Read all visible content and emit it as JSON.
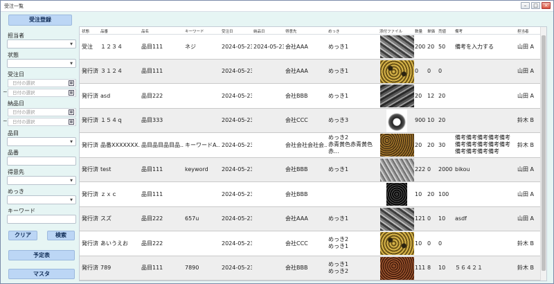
{
  "window": {
    "title": "受注一覧"
  },
  "sidebar": {
    "register_button": "受注登録",
    "tanto_label": "担当者",
    "status_label": "状態",
    "order_date_label": "受注日",
    "delivery_date_label": "納品日",
    "date_placeholder": "日付の選択",
    "tilde": "~",
    "item_label": "品目",
    "part_no_label": "品番",
    "customer_label": "得意先",
    "plating_label": "めっき",
    "keyword_label": "キーワード",
    "clear_button": "クリア",
    "search_button": "検索",
    "schedule_button": "予定表",
    "master_button": "マスタ"
  },
  "grid": {
    "headers": [
      "状態",
      "品番",
      "品名",
      "キーワード",
      "受注日",
      "納品日",
      "得意先",
      "めっき",
      "添付ファイル",
      "数量",
      "単価",
      "売値",
      "備考",
      "担当者"
    ],
    "rows": [
      {
        "status": "受注",
        "part_no": "１２３４",
        "name": "品目111",
        "keyword": "ネジ",
        "order_date": "2024-05-23",
        "delivery_date": "2024-05-23",
        "customer": "会社AAA",
        "plating": "めっき1",
        "thumb": "screws-gray",
        "qty": "200",
        "unit": "20",
        "price": "50",
        "note": "備考を入力する",
        "tanto": "山田 A"
      },
      {
        "status": "発行済",
        "part_no": "３１２４",
        "name": "品目111",
        "keyword": "",
        "order_date": "2024-05-23",
        "delivery_date": "",
        "customer": "会社AAA",
        "plating": "めっき1",
        "thumb": "rings-gold",
        "qty": "0",
        "unit": "0",
        "price": "0",
        "note": "",
        "tanto": "山田 A"
      },
      {
        "status": "発行済",
        "part_no": "asd",
        "name": "品目222",
        "keyword": "",
        "order_date": "2024-05-23",
        "delivery_date": "",
        "customer": "会社BBB",
        "plating": "めっき1",
        "thumb": "screws-dark",
        "qty": "20",
        "unit": "12",
        "price": "20",
        "note": "",
        "tanto": "山田 A"
      },
      {
        "status": "発行済",
        "part_no": "１５４ｑ",
        "name": "品目333",
        "keyword": "",
        "order_date": "2024-05-23",
        "delivery_date": "",
        "customer": "会社CCC",
        "plating": "めっき3",
        "thumb": "gear-single",
        "qty": "900",
        "unit": "10",
        "price": "20",
        "note": "",
        "tanto": "鈴木 B"
      },
      {
        "status": "発行済",
        "part_no": "品番XXXXXXX...",
        "name": "品目品目品目品...",
        "keyword": "キーワードA...",
        "order_date": "2024-05-23",
        "delivery_date": "",
        "customer": "会社会社会社会...",
        "plating": "めっき2\n赤青黄色赤青黄色赤...",
        "thumb": "granules-brown",
        "qty": "20",
        "unit": "20",
        "price": "30",
        "note": "備考備考備考備考備考\n備考備考備考備考備考\n備考備考備考備考",
        "tanto": "鈴木 B"
      },
      {
        "status": "発行済",
        "part_no": "test",
        "name": "品目111",
        "keyword": "keyword",
        "order_date": "2024-05-23",
        "delivery_date": "",
        "customer": "会社BBB",
        "plating": "めっき1",
        "thumb": "screws-silver",
        "qty": "222",
        "unit": "0",
        "price": "2000",
        "note": "bikou",
        "tanto": "山田 A"
      },
      {
        "status": "発行済",
        "part_no": "ｚｘｃ",
        "name": "品目111",
        "keyword": "",
        "order_date": "2024-05-23",
        "delivery_date": "",
        "customer": "会社BBB",
        "plating": "",
        "thumb": "granules-black",
        "qty": "10",
        "unit": "20",
        "price": "100",
        "note": "",
        "tanto": "山田 A"
      },
      {
        "status": "発行済",
        "part_no": "スズ",
        "name": "品目222",
        "keyword": "657u",
        "order_date": "2024-05-23",
        "delivery_date": "",
        "customer": "会社AAA",
        "plating": "めっき1",
        "thumb": "screws-gray",
        "qty": "121",
        "unit": "0",
        "price": "10",
        "note": "asdf",
        "tanto": "山田 A"
      },
      {
        "status": "発行済",
        "part_no": "あいうえお",
        "name": "品目222",
        "keyword": "",
        "order_date": "2024-05-23",
        "delivery_date": "",
        "customer": "会社CCC",
        "plating": "めっき2\nめっき1",
        "thumb": "rings-gold",
        "qty": "10",
        "unit": "0",
        "price": "0",
        "note": "",
        "tanto": "鈴木 B"
      },
      {
        "status": "発行済",
        "part_no": "789",
        "name": "品目111",
        "keyword": "7890",
        "order_date": "2024-05-23",
        "delivery_date": "",
        "customer": "会社BBB",
        "plating": "めっき1\nめっき2",
        "thumb": "granules-copper",
        "qty": "111",
        "unit": "8",
        "price": "10",
        "note": "５６４２１",
        "tanto": "鈴木 B"
      }
    ]
  },
  "colors": {
    "accent_button": "#bcd6f5",
    "background": "#e6f5f4",
    "alt_row": "#eeeeee"
  }
}
